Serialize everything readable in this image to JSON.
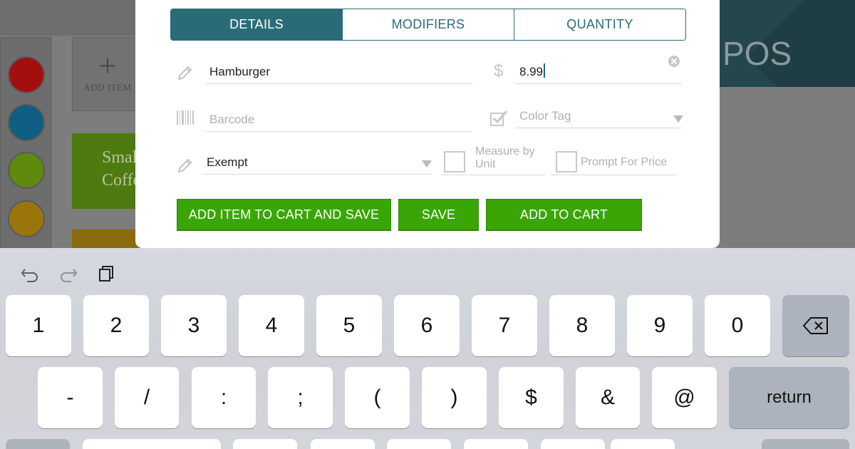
{
  "background": {
    "add_item_label": "ADD ITEM",
    "coffee_tile_label": "Small Coffee",
    "pos_title": "POS",
    "swatch_colors": [
      "#a30f0f",
      "#0f5f82",
      "#5f8a0e",
      "#9a750c"
    ]
  },
  "modal": {
    "tabs": [
      {
        "label": "DETAILS",
        "active": true
      },
      {
        "label": "MODIFIERS",
        "active": false
      },
      {
        "label": "QUANTITY",
        "active": false
      }
    ],
    "name_value": "Hamburger",
    "price_value": "8.99",
    "barcode_placeholder": "Barcode",
    "color_tag_placeholder": "Color Tag",
    "tax_value": "Exempt",
    "measure_by_unit_label_1": "Measure by",
    "measure_by_unit_label_2": "Unit",
    "prompt_for_price_label": "Prompt For Price",
    "buttons": {
      "add_and_save": "ADD ITEM TO CART AND SAVE",
      "save": "SAVE",
      "add_to_cart": "ADD TO CART"
    },
    "accent_color": "#2a6b78",
    "button_color": "#39a605"
  },
  "keyboard": {
    "row1": [
      "1",
      "2",
      "3",
      "4",
      "5",
      "6",
      "7",
      "8",
      "9",
      "0"
    ],
    "row2": [
      "-",
      "/",
      ":",
      ";",
      "(",
      ")",
      "$",
      "&",
      "@"
    ],
    "return_label": "return",
    "icons": [
      "undo-icon",
      "redo-icon",
      "paste-icon",
      "backspace-icon"
    ]
  }
}
